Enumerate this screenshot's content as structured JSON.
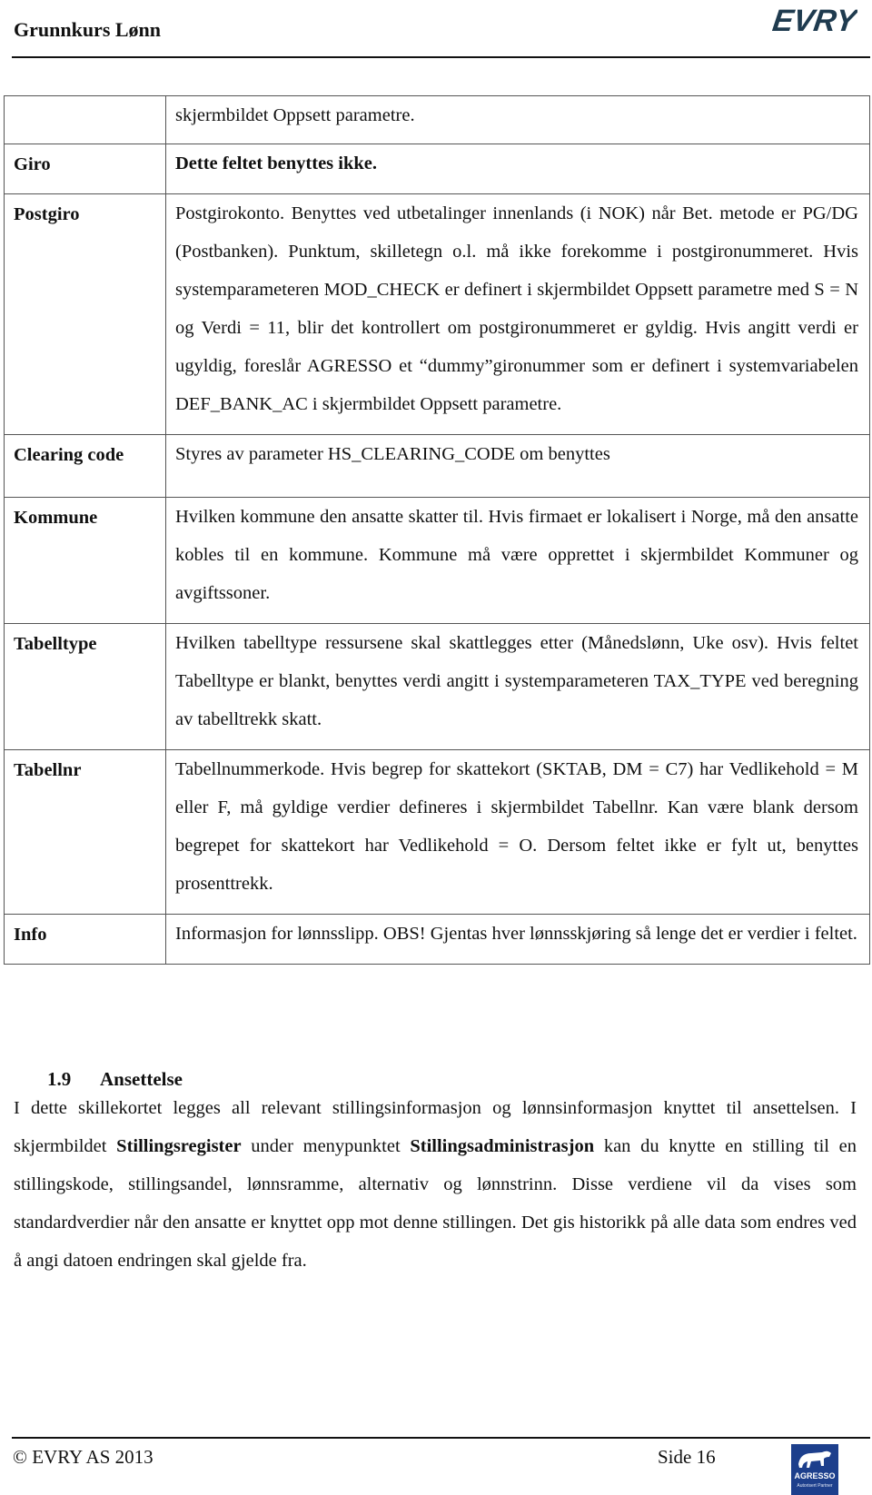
{
  "header": {
    "title": "Grunnkurs Lønn",
    "logo_icon": "evry-logo",
    "logo_text": "EVRY",
    "logo_color": "#1f3b4f"
  },
  "table": {
    "rows": [
      {
        "label": "",
        "description": "skjermbildet Oppsett parametre."
      },
      {
        "label": "Giro",
        "description": "Dette feltet benyttes ikke.",
        "description_bold": true
      },
      {
        "label": "Postgiro",
        "description": "Postgirokonto. Benyttes ved utbetalinger innenlands (i NOK) når Bet. metode er PG/DG (Postbanken). Punktum, skilletegn o.l. må ikke forekomme i postgironummeret. Hvis systemparameteren MOD_CHECK er definert i skjermbildet Oppsett parametre med S = N og Verdi = 11, blir det kontrollert om postgironummeret er gyldig. Hvis angitt verdi er ugyldig, foreslår AGRESSO et “dummy”gironummer som er definert i systemvariabelen DEF_BANK_AC i skjermbildet Oppsett parametre."
      },
      {
        "label": "Clearing code",
        "description": "Styres av parameter HS_CLEARING_CODE om benyttes"
      },
      {
        "label": "Kommune",
        "description": "Hvilken kommune den ansatte skatter til. Hvis firmaet er lokalisert i Norge, må den ansatte kobles til en kommune. Kommune må være opprettet i skjermbildet Kommuner og avgiftssoner."
      },
      {
        "label": "Tabelltype",
        "description": "Hvilken tabelltype ressursene skal skattlegges etter (Månedslønn, Uke osv). Hvis feltet Tabelltype er blankt, benyttes verdi angitt i systemparameteren TAX_TYPE ved beregning av tabelltrekk skatt."
      },
      {
        "label": "Tabellnr",
        "description": "Tabellnummerkode. Hvis begrep for skattekort (SKTAB, DM = C7) har Vedlikehold = M eller F, må gyldige verdier defineres i skjermbildet Tabellnr. Kan være blank dersom begrepet for skattekort har Vedlikehold = O. Dersom feltet ikke er fylt ut, benyttes prosenttrekk."
      },
      {
        "label": "Info",
        "description": "Informasjon for lønnsslipp. OBS! Gjentas hver lønnsskjøring så lenge det er verdier i feltet."
      }
    ]
  },
  "section": {
    "number": "1.9",
    "title": "Ansettelse",
    "body": {
      "part1": "I dette skillekortet legges all relevant stillingsinformasjon og lønnsinformasjon knyttet til ansettelsen.  I skjermbildet ",
      "bold1": "Stillingsregister",
      "part2": " under menypunktet ",
      "bold2": "Stillingsadministrasjon",
      "part3": " kan du knytte en stilling til en stillingskode, stillingsandel, lønnsramme, alternativ og lønnstrinn. Disse verdiene vil da vises som standardverdier når den ansatte er knyttet opp mot denne stillingen. Det gis historikk på alle data som endres ved å angi datoen endringen skal gjelde fra."
    }
  },
  "footer": {
    "copyright": "© EVRY AS 2013",
    "page": "Side 16",
    "partner_logo_icon": "agresso-bull-logo",
    "partner_logo_text": "AGRESSO",
    "partner_logo_subtext": "Autorisert Partner",
    "partner_logo_color": "#1d3f8c"
  }
}
